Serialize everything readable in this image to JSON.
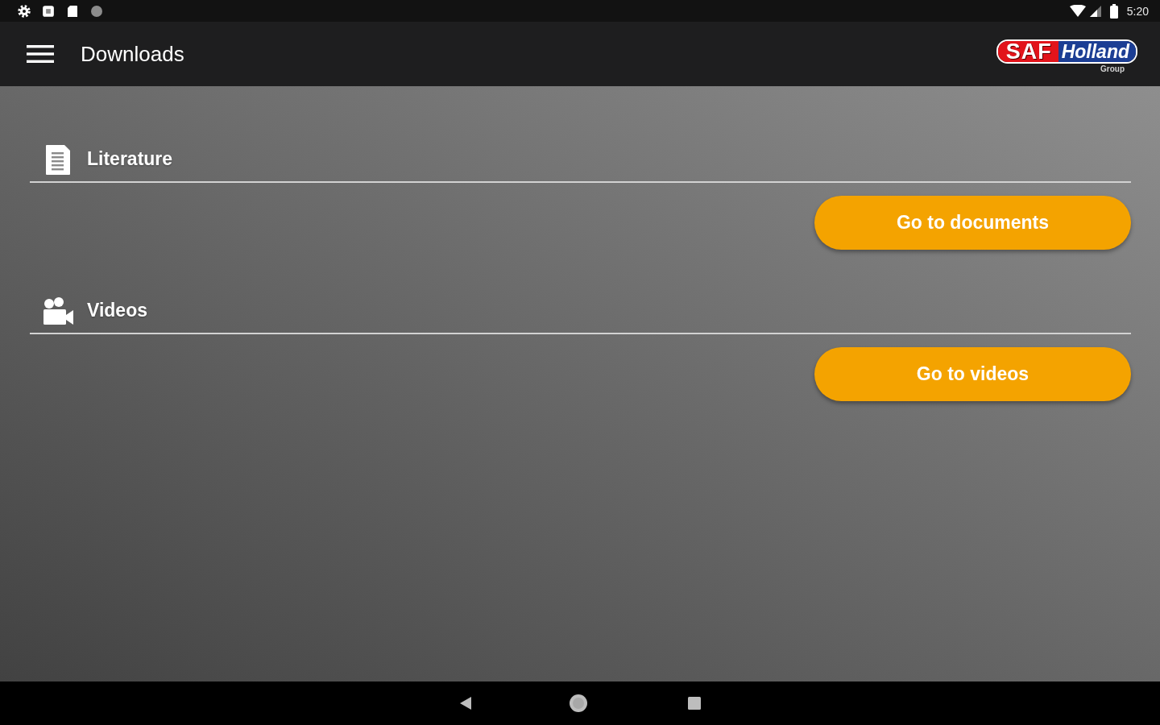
{
  "status_bar": {
    "time": "5:20"
  },
  "app_bar": {
    "title": "Downloads",
    "logo": {
      "primary": "SAF",
      "secondary": "Holland",
      "tagline": "Group"
    }
  },
  "sections": [
    {
      "kind": "literature",
      "title": "Literature",
      "button": "Go to documents"
    },
    {
      "kind": "videos",
      "title": "Videos",
      "button": "Go to videos"
    }
  ]
}
